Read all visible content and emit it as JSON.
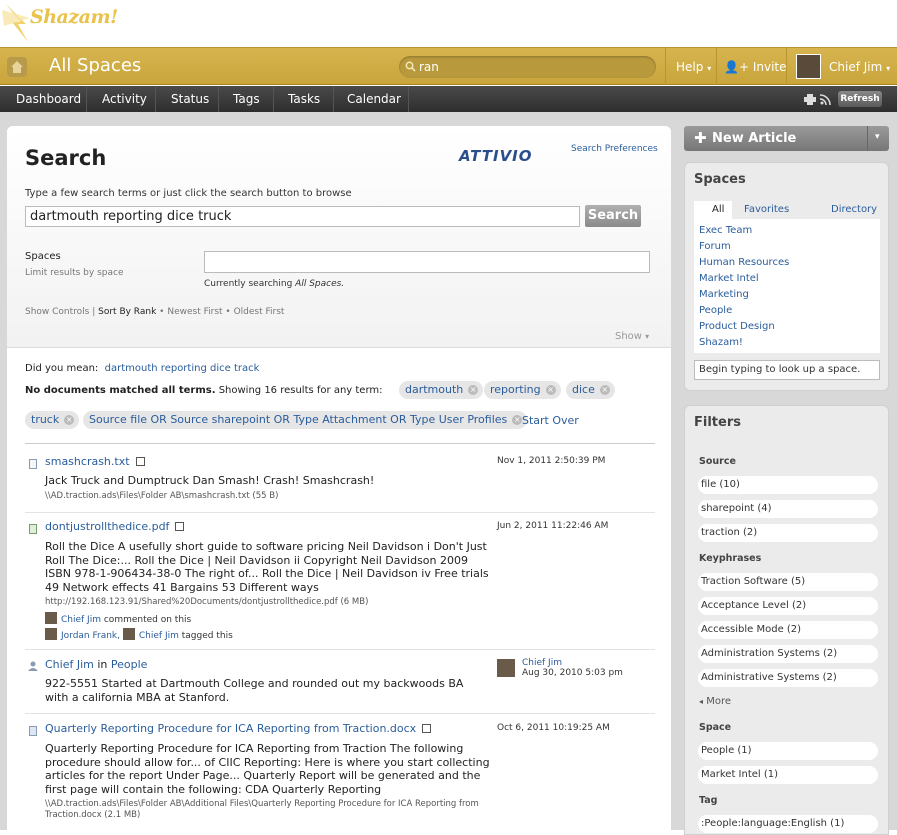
{
  "logo": {
    "text": "Shazam!"
  },
  "topbar": {
    "title": "All Spaces",
    "search_value": "ran",
    "help": "Help",
    "invite": "Invite",
    "user": "Chief Jim"
  },
  "nav": {
    "items": [
      "Dashboard",
      "Activity",
      "Status",
      "Tags",
      "Tasks",
      "Calendar"
    ],
    "refresh": "Refresh"
  },
  "search": {
    "title": "Search",
    "brand": "ATTIVIO",
    "preferences": "Search Preferences",
    "hint": "Type a few search terms or just click the search button to browse",
    "query": "dartmouth reporting dice truck",
    "button": "Search",
    "spaces_label": "Spaces",
    "spaces_sub": "Limit results by space",
    "searching_prefix": "Currently searching ",
    "searching_value": "All Spaces.",
    "controls": {
      "show_controls": "Show Controls",
      "sort_by_rank": "Sort By Rank",
      "newest": "Newest First",
      "oldest": "Oldest First"
    },
    "show": "Show"
  },
  "results": {
    "did_you_mean_label": "Did you mean:",
    "did_you_mean_value": "dartmouth reporting dice track",
    "nomatch_bold": "No documents matched all terms.",
    "nomatch_rest": "Showing 16 results for any term:",
    "chips": [
      "dartmouth",
      "reporting",
      "dice",
      "truck",
      "Source file OR Source sharepoint OR Type Attachment OR Type User Profiles"
    ],
    "start_over": "Start Over",
    "items": [
      {
        "title": "smashcrash.txt",
        "date": "Nov 1, 2011 2:50:39 PM",
        "body": "Jack Truck and Dumptruck Dan Smash! Crash! Smashcrash!",
        "path": "\\\\AD.traction.ads\\Files\\Folder AB\\smashcrash.txt (55 B)"
      },
      {
        "title": "dontjustrollthedice.pdf",
        "date": "Jun 2, 2011 11:22:46 AM",
        "body": "Roll the Dice A usefully short guide to software pricing Neil Davidson i Don't Just Roll The Dice:... Roll the Dice | Neil Davidson ii Copyright Neil Davidson 2009 ISBN 978-1-906434-38-0 The right of... Roll the Dice | Neil Davidson iv Free trials 49 Network effects 41 Bargains 53 Different ways",
        "path": "http://192.168.123.91/Shared%20Documents/dontjustrollthedice.pdf (6 MB)",
        "comment_user": "Chief Jim",
        "comment_text": "commented on this",
        "tag_user1": "Jordan Frank,",
        "tag_user2": "Chief Jim",
        "tag_text": "tagged this"
      },
      {
        "title_user": "Chief Jim",
        "title_in": "in",
        "title_space": "People",
        "meta_user": "Chief Jim",
        "date": "Aug 30, 2010 5:03 pm",
        "body": "922-5551 Started at Dartmouth College and rounded out my backwoods BA with a california MBA at Stanford."
      },
      {
        "title": "Quarterly Reporting Procedure for ICA Reporting from Traction.docx",
        "date": "Oct 6, 2011 10:19:25 AM",
        "body": "Quarterly Reporting Procedure for ICA Reporting from Traction The following procedure should allow for... of CIIC Reporting: Here is where you start collecting articles for the report Under Page... Quarterly Report will be generated and the first page will contain the following: CDA Quarterly Reporting",
        "path": "\\\\AD.traction.ads\\Files\\Folder AB\\Additional Files\\Quarterly Reporting Procedure for ICA Reporting from Traction.docx (2.1 MB)"
      }
    ]
  },
  "sidebar": {
    "new_article": "New Article",
    "spaces": {
      "title": "Spaces",
      "tabs": [
        "All",
        "Favorites",
        "Directory"
      ],
      "list": [
        "Exec Team",
        "Forum",
        "Human Resources",
        "Market Intel",
        "Marketing",
        "People",
        "Product Design",
        "Shazam!"
      ],
      "lookup": "Begin typing to look up a space."
    },
    "filters": {
      "title": "Filters",
      "source_title": "Source",
      "source": [
        "file (10)",
        "sharepoint (4)",
        "traction (2)"
      ],
      "key_title": "Keyphrases",
      "key": [
        "Traction Software (5)",
        "Acceptance Level (2)",
        "Accessible Mode (2)",
        "Administration Systems (2)",
        "Administrative Systems (2)"
      ],
      "more": "More",
      "space_title": "Space",
      "space": [
        "People (1)",
        "Market Intel (1)"
      ],
      "tag_title": "Tag",
      "tag": [
        ":People:language:English (1)"
      ]
    }
  }
}
